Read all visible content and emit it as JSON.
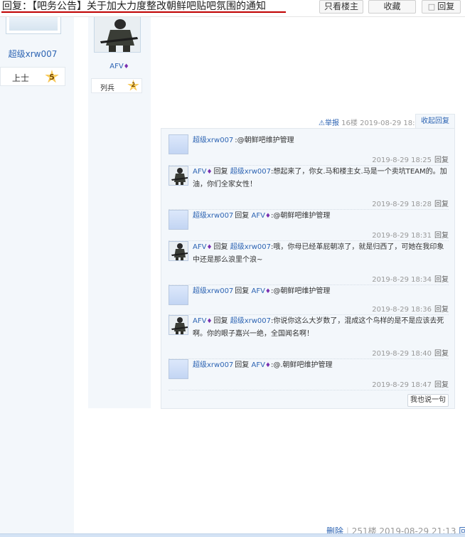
{
  "header": {
    "title": "回复：【吧务公告】关于加大力度整改朝鲜吧贴吧氛围的通知",
    "only_owner_label": "只看楼主",
    "favorite_label": "收藏",
    "reply_label": "回复"
  },
  "left_user": {
    "username": "超级xrw007",
    "rank": "上士",
    "level": "5"
  },
  "author": {
    "name": "AFV",
    "rank": "列兵",
    "level": "2"
  },
  "post_meta": {
    "report": "举报",
    "floor": "16楼",
    "time": "2019-08-29 18:09",
    "collapse": "收起回复"
  },
  "replies": [
    {
      "user": "超级xrw007",
      "reply_word": "",
      "target": "",
      "text": ":@朝鲜吧维护管理",
      "time": "2019-8-29 18:25",
      "reply": "回复"
    },
    {
      "user": "AFV",
      "reply_word": "回复",
      "target": "超级xrw007",
      "text": ":想起来了，你女.马和楼主女.马是一个卖坑TEAM的。加油，你们全家女性！",
      "time": "2019-8-29 18:28",
      "reply": "回复"
    },
    {
      "user": "超级xrw007",
      "reply_word": "回复",
      "target": "AFV",
      "text": ":@朝鲜吧维护管理",
      "time": "2019-8-29 18:31",
      "reply": "回复"
    },
    {
      "user": "AFV",
      "reply_word": "回复",
      "target": "超级xrw007",
      "text": ":哦，你母已经革屁朝凉了，就是归西了，可她在我印象中还是那么浪里个浪~",
      "time": "2019-8-29 18:34",
      "reply": "回复"
    },
    {
      "user": "超级xrw007",
      "reply_word": "回复",
      "target": "AFV",
      "text": ":@朝鲜吧维护管理",
      "time": "2019-8-29 18:36",
      "reply": "回复"
    },
    {
      "user": "AFV",
      "reply_word": "回复",
      "target": "超级xrw007",
      "text": ":你说你这么大岁数了，混成这个鸟样的是不是应该去死啊。你的眼子嘉兴一绝，全国闻名啊！",
      "time": "2019-8-29 18:40",
      "reply": "回复"
    },
    {
      "user": "超级xrw007",
      "reply_word": "回复",
      "target": "AFV",
      "text": ":@.朝鲜吧维护管理",
      "time": "2019-8-29 18:47",
      "reply": "回复"
    }
  ],
  "say_button": "我也说一句",
  "bottom": {
    "delete": "删除",
    "floor": "251楼",
    "time": "2019-08-29 21:13",
    "reply": "回复"
  }
}
